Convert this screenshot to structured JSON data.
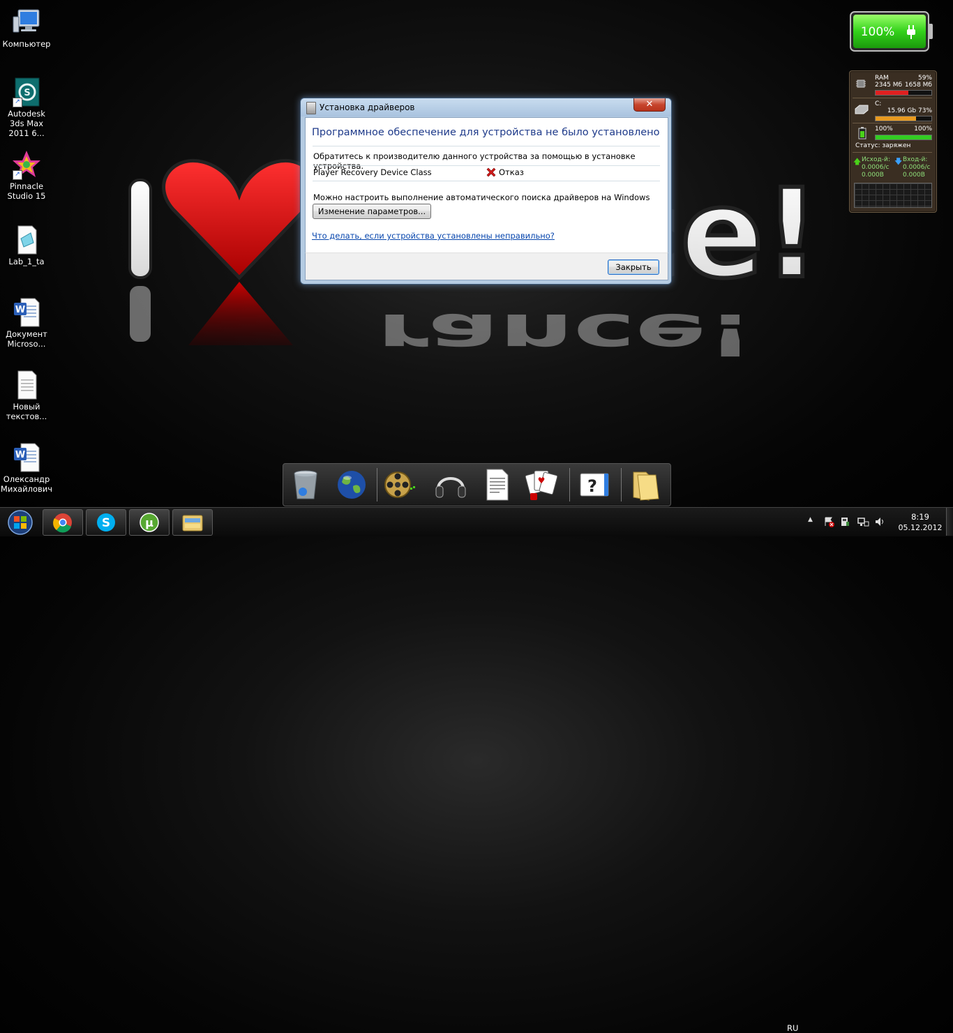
{
  "wallpaper": {
    "left_word": "I",
    "right_word": "Trance!"
  },
  "desktop_icons": [
    {
      "label": "Компьютер",
      "icon": "computer-icon"
    },
    {
      "label": "Autodesk 3ds Max 2011 6...",
      "icon": "3ds-max-icon"
    },
    {
      "label": "Pinnacle Studio 15",
      "icon": "pinnacle-studio-icon"
    },
    {
      "label": "Lab_1_ta",
      "icon": "document-icon"
    },
    {
      "label": "Документ Microsо...",
      "icon": "word-document-icon"
    },
    {
      "label": "Новый текстов...",
      "icon": "text-file-icon"
    },
    {
      "label": "Олександр Михайлович",
      "icon": "word-document-icon"
    }
  ],
  "battery_gadget": {
    "percent_text": "100%",
    "level": 1.0
  },
  "system_monitor": {
    "ram_label": "RAM",
    "ram_percent": "59%",
    "ram_total": "2345 Мб",
    "ram_free": "1658 Мб",
    "ram_level": 0.59,
    "disk_label": "C:",
    "disk_info": "15.96 Gb 73%",
    "disk_level": 0.73,
    "battery_left": "100%",
    "battery_right": "100%",
    "battery_level": 1.0,
    "status_text": "Статус: заряжен",
    "out_label": "Исход-й:",
    "out_rate": "0.0006/с",
    "out_total": "0.000В",
    "in_label": "Вход-й:",
    "in_rate": "0.0006/с",
    "in_total": "0.000В"
  },
  "dialog": {
    "title": "Установка драйверов",
    "close_glyph": "✕",
    "heading": "Программное обеспечение для устройства не было установлено",
    "instruction": "Обратитесь к производителю данного устройства за помощью в установке устройства.",
    "device_name": "Player Recovery Device Class",
    "device_status": "Отказ",
    "update_text": "Можно настроить выполнение автоматического поиска драйверов на Windows Update",
    "change_settings_label": "Изменение параметров...",
    "help_link": "Что делать, если устройства установлены неправильно?",
    "close_button_label": "Закрыть",
    "accent_color": "#1e3a8a",
    "link_color": "#0645ad",
    "error_color": "#d11a1a"
  },
  "dock_items": [
    {
      "icon": "recycle-bin-icon"
    },
    {
      "icon": "globe-icon"
    },
    {
      "icon": "film-reel-icon"
    },
    {
      "icon": "headphones-icon"
    },
    {
      "icon": "document-icon"
    },
    {
      "icon": "playing-cards-icon"
    },
    {
      "icon": "help-icon"
    },
    {
      "icon": "folder-icon"
    }
  ],
  "taskbar": {
    "pinned": [
      {
        "icon": "chrome-icon"
      },
      {
        "icon": "skype-icon"
      },
      {
        "icon": "utorrent-icon"
      },
      {
        "icon": "explorer-icon"
      }
    ],
    "language": "RU",
    "time": "8:19",
    "date": "05.12.2012"
  }
}
